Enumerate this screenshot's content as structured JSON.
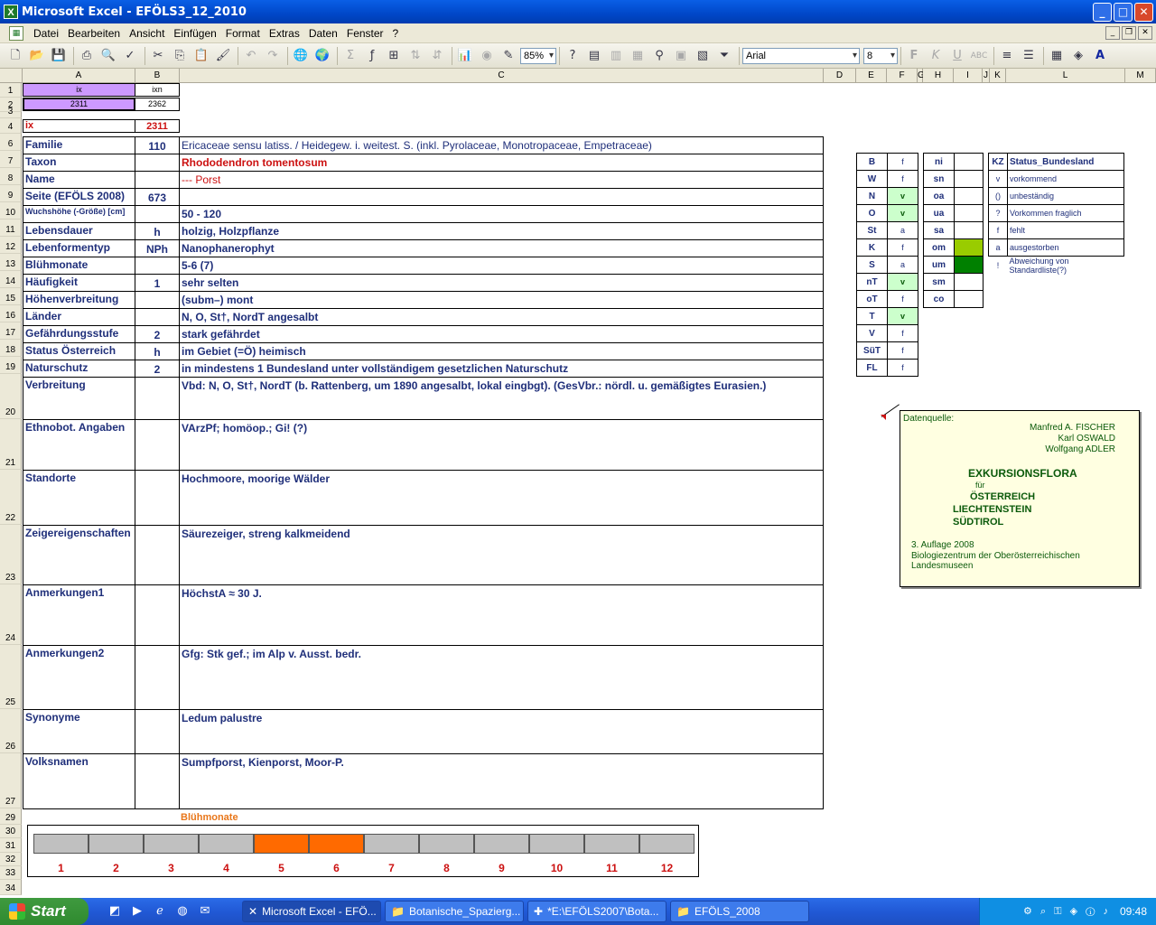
{
  "window": {
    "title": "Microsoft Excel - EFÖLS3_12_2010",
    "app_icon": "X",
    "min": "_",
    "max": "□",
    "close": "✕"
  },
  "menu": [
    "Datei",
    "Bearbeiten",
    "Ansicht",
    "Einfügen",
    "Format",
    "Extras",
    "Daten",
    "Fenster",
    "?"
  ],
  "toolbar": {
    "zoom": "85%",
    "font": "Arial",
    "size": "8"
  },
  "columns": [
    "A",
    "B",
    "C",
    "D",
    "E",
    "F",
    "G",
    "H",
    "I",
    "J",
    "K",
    "L",
    "M"
  ],
  "rows": [
    "1",
    "2",
    "3",
    "4",
    "6",
    "7",
    "8",
    "9",
    "10",
    "11",
    "12",
    "13",
    "14",
    "15",
    "16",
    "17",
    "18",
    "19",
    "20",
    "21",
    "22",
    "23",
    "24",
    "25",
    "26",
    "27",
    "29",
    "30",
    "31",
    "32",
    "33",
    "34"
  ],
  "header_cells": {
    "a1": "ix",
    "b1": "ixn",
    "a2": "2311",
    "b2": "2362",
    "a4": "ix",
    "b4": "2311"
  },
  "records": [
    {
      "label": "Familie",
      "code": "110",
      "value": "Ericaceae sensu latiss.  /  Heidegew. i. weitest. S. (inkl. Pyrolaceae, Monotropaceae, Empetraceae)"
    },
    {
      "label": "Taxon",
      "code": "",
      "value": "Rhododendron tomentosum"
    },
    {
      "label": "Name",
      "code": "",
      "value": "--- Porst"
    },
    {
      "label": "Seite (EFÖLS 2008)",
      "code": "673",
      "value": ""
    },
    {
      "label": "Wuchshöhe (-Größe) [cm]",
      "code": "",
      "value": " 50 - 120"
    },
    {
      "label": "Lebensdauer",
      "code": "h",
      "value": "holzig, Holzpflanze"
    },
    {
      "label": "Lebenformentyp",
      "code": "NPh",
      "value": "Nanophanerophyt"
    },
    {
      "label": "Blühmonate",
      "code": "",
      "value": " 5-6 (7)"
    },
    {
      "label": "Häufigkeit",
      "code": "1",
      "value": "sehr selten"
    },
    {
      "label": "Höhenverbreitung",
      "code": "",
      "value": "(subm–) mont"
    },
    {
      "label": "Länder",
      "code": "",
      "value": "N, O, St†, NordT angesalbt"
    },
    {
      "label": "Gefährdungsstufe",
      "code": "2",
      "value": "stark gefährdet"
    },
    {
      "label": "Status Österreich",
      "code": "h",
      "value": "im Gebiet (=Ö) heimisch"
    },
    {
      "label": "Naturschutz",
      "code": "2",
      "value": "in mindestens 1 Bundesland unter vollständigem gesetzlichen Naturschutz"
    }
  ],
  "big_records": [
    {
      "label": "Verbreitung",
      "value": "Vbd: N, O, St†, NordT (b. Rattenberg, um 1890 angesalbt, lokal eingbgt). (GesVbr.: nördl. u. gemäßigtes Eurasien.)"
    },
    {
      "label": "Ethnobot. Angaben",
      "value": "VArzPf; homöop.; Gi! (?)"
    },
    {
      "label": "Standorte",
      "value": "Hochmoore, moorige Wälder"
    },
    {
      "label": "Zeigereigenschaften",
      "value": "Säurezeiger, streng kalkmeidend"
    },
    {
      "label": "Anmerkungen1",
      "value": "HöchstA ≈ 30 J."
    },
    {
      "label": "Anmerkungen2",
      "value": "Gfg: Stk gef.; im Alp v. Ausst. bedr."
    },
    {
      "label": "Synonyme",
      "value": "Ledum palustre"
    },
    {
      "label": "Volksnamen",
      "value": "Sumpfporst, Kienporst, Moor-P."
    }
  ],
  "states": [
    {
      "code": "B",
      "status": "f"
    },
    {
      "code": "W",
      "status": "f"
    },
    {
      "code": "N",
      "status": "v"
    },
    {
      "code": "O",
      "status": "v"
    },
    {
      "code": "St",
      "status": "a"
    },
    {
      "code": "K",
      "status": "f"
    },
    {
      "code": "S",
      "status": "a"
    },
    {
      "code": "nT",
      "status": "v"
    },
    {
      "code": "oT",
      "status": "f"
    },
    {
      "code": "T",
      "status": "v"
    },
    {
      "code": "V",
      "status": "f"
    },
    {
      "code": "SüT",
      "status": "f"
    },
    {
      "code": "FL",
      "status": "f"
    }
  ],
  "regions": [
    "ni",
    "sn",
    "oa",
    "ua",
    "sa",
    "om",
    "um",
    "sm",
    "co"
  ],
  "legend": {
    "header_kz": "KZ",
    "header_status": "Status_Bundesland",
    "items": [
      {
        "kz": "v",
        "text": "vorkommend"
      },
      {
        "kz": "()",
        "text": "unbeständig"
      },
      {
        "kz": "?",
        "text": "Vorkommen fraglich"
      },
      {
        "kz": "f",
        "text": "fehlt"
      },
      {
        "kz": "a",
        "text": "ausgestorben"
      },
      {
        "kz": "!",
        "text": "Abweichung von Standardliste(?)"
      }
    ]
  },
  "note": {
    "heading": "Datenquelle:",
    "author1": "Manfred A. FISCHER",
    "author2": "Karl OSWALD",
    "author3": "Wolfgang ADLER",
    "title1": "EXKURSIONSFLORA",
    "title2": "für",
    "title3": "ÖSTERREICH",
    "title4": "LIECHTENSTEIN",
    "title5": "SÜDTIROL",
    "edition": "3. Auflage 2008",
    "publisher": "Biologiezentrum der Oberösterreichischen Landesmuseen"
  },
  "bloom": {
    "title": "Blühmonate",
    "months": [
      "1",
      "2",
      "3",
      "4",
      "5",
      "6",
      "7",
      "8",
      "9",
      "10",
      "11",
      "12"
    ],
    "flowering": [
      5,
      6
    ],
    "color_on": "#ff6a00",
    "color_off": "#c0c0c0"
  },
  "taskbar": {
    "start": "Start",
    "tasks": [
      "Microsoft Excel - EFÖ...",
      "Botanische_Spazierg...",
      "*E:\\EFÖLS2007\\Bota...",
      "EFÖLS_2008"
    ],
    "clock": "09:48"
  }
}
